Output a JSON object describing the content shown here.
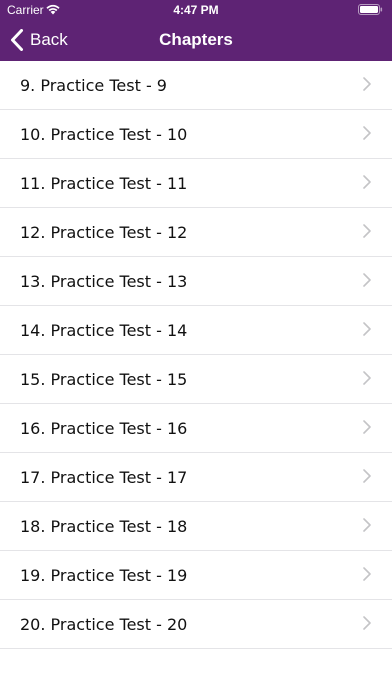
{
  "status_bar": {
    "carrier": "Carrier",
    "time": "4:47 PM",
    "wifi_icon": "wifi-icon",
    "battery_icon": "battery-icon"
  },
  "navbar": {
    "back_label": "Back",
    "back_icon": "chevron-left-icon",
    "title": "Chapters"
  },
  "chapters": [
    {
      "label": "9. Practice Test - 9"
    },
    {
      "label": "10. Practice Test - 10"
    },
    {
      "label": "11. Practice Test - 11"
    },
    {
      "label": "12. Practice Test - 12"
    },
    {
      "label": "13. Practice Test - 13"
    },
    {
      "label": "14. Practice Test - 14"
    },
    {
      "label": "15. Practice Test - 15"
    },
    {
      "label": "16. Practice Test - 16"
    },
    {
      "label": "17. Practice Test - 17"
    },
    {
      "label": "18. Practice Test - 18"
    },
    {
      "label": "19. Practice Test - 19"
    },
    {
      "label": "20. Practice Test - 20"
    }
  ],
  "row_chevron_icon": "chevron-right-icon",
  "colors": {
    "navbar_background": "#5e2374",
    "navbar_text": "#ffffff",
    "row_text": "#111111",
    "separator": "#e4e4e7",
    "chevron": "#c4c4c7"
  }
}
